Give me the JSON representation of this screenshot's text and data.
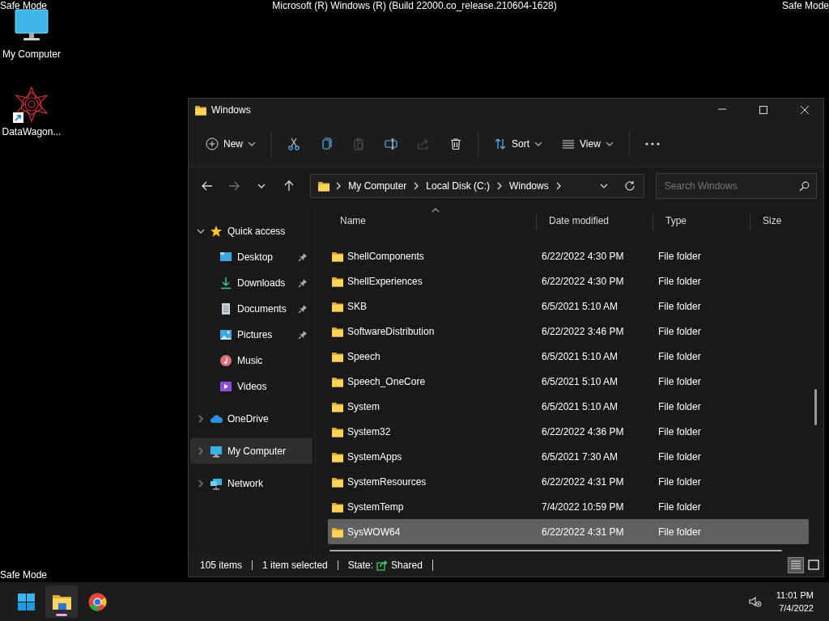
{
  "safe_mode_labels": [
    "Safe Mode",
    "Safe Mode",
    "Safe Mode"
  ],
  "build_title": "Microsoft (R) Windows (R) (Build 22000.co_release.210604-1628)",
  "desktop_icons": [
    {
      "label": "My Computer",
      "shortcut": false
    },
    {
      "label": "DataWagon...",
      "shortcut": true
    }
  ],
  "window": {
    "title": "Windows",
    "toolbar": [
      {
        "kind": "menu",
        "label": "New"
      },
      {
        "kind": "separator"
      },
      {
        "kind": "icon",
        "disabled": false
      },
      {
        "kind": "icon",
        "disabled": false
      },
      {
        "kind": "icon",
        "disabled": true
      },
      {
        "kind": "icon",
        "disabled": false
      },
      {
        "kind": "icon",
        "disabled": true
      },
      {
        "kind": "icon",
        "disabled": false
      },
      {
        "kind": "separator"
      },
      {
        "kind": "menu",
        "label": "Sort"
      },
      {
        "kind": "menu",
        "label": "View"
      },
      {
        "kind": "separator"
      },
      {
        "kind": "more"
      }
    ],
    "nav_buttons": [
      {
        "disabled": false
      },
      {
        "disabled": true
      },
      {
        "disabled": false
      },
      {
        "disabled": false
      }
    ],
    "address": {
      "crumbs": [
        "My Computer",
        "Local Disk (C:)",
        "Windows"
      ]
    },
    "search": {
      "placeholder": "Search Windows"
    },
    "nav_pane": [
      {
        "label": "Quick access",
        "expanded": true,
        "selected": false,
        "children": [
          {
            "label": "Desktop",
            "pinned": true,
            "selected": false
          },
          {
            "label": "Downloads",
            "pinned": true,
            "selected": false
          },
          {
            "label": "Documents",
            "pinned": true,
            "selected": false
          },
          {
            "label": "Pictures",
            "pinned": true,
            "selected": false
          },
          {
            "label": "Music",
            "pinned": false,
            "selected": false
          },
          {
            "label": "Videos",
            "pinned": false,
            "selected": false
          }
        ]
      },
      {
        "label": "OneDrive",
        "expanded": false,
        "selected": false
      },
      {
        "label": "My Computer",
        "expanded": false,
        "selected": true
      },
      {
        "label": "Network",
        "expanded": false,
        "selected": false
      }
    ],
    "columns": [
      {
        "label": "Name",
        "sorted": true
      },
      {
        "label": "Date modified",
        "sorted": false
      },
      {
        "label": "Type",
        "sorted": false
      },
      {
        "label": "Size",
        "sorted": false
      }
    ],
    "rows": [
      {
        "name": "ShellComponents",
        "date": "6/22/2022 4:30 PM",
        "type": "File folder",
        "selected": false
      },
      {
        "name": "ShellExperiences",
        "date": "6/22/2022 4:30 PM",
        "type": "File folder",
        "selected": false
      },
      {
        "name": "SKB",
        "date": "6/5/2021 5:10 AM",
        "type": "File folder",
        "selected": false
      },
      {
        "name": "SoftwareDistribution",
        "date": "6/22/2022 3:46 PM",
        "type": "File folder",
        "selected": false
      },
      {
        "name": "Speech",
        "date": "6/5/2021 5:10 AM",
        "type": "File folder",
        "selected": false
      },
      {
        "name": "Speech_OneCore",
        "date": "6/5/2021 5:10 AM",
        "type": "File folder",
        "selected": false
      },
      {
        "name": "System",
        "date": "6/5/2021 5:10 AM",
        "type": "File folder",
        "selected": false
      },
      {
        "name": "System32",
        "date": "6/22/2022 4:36 PM",
        "type": "File folder",
        "selected": false
      },
      {
        "name": "SystemApps",
        "date": "6/5/2021 7:30 AM",
        "type": "File folder",
        "selected": false
      },
      {
        "name": "SystemResources",
        "date": "6/22/2022 4:31 PM",
        "type": "File folder",
        "selected": false
      },
      {
        "name": "SystemTemp",
        "date": "7/4/2022 10:59 PM",
        "type": "File folder",
        "selected": false
      },
      {
        "name": "SysWOW64",
        "date": "6/22/2022 4:31 PM",
        "type": "File folder",
        "selected": true
      }
    ],
    "status": {
      "item_count": "105 items",
      "selection": "1 item selected",
      "state_label": "State:",
      "state_value": "Shared"
    },
    "view_buttons": [
      {
        "selected": true
      },
      {
        "selected": false
      }
    ]
  },
  "taskbar": {
    "apps": [
      {
        "active": false
      },
      {
        "active": true
      },
      {
        "active": false
      }
    ],
    "time": "11:01 PM",
    "date": "7/4/2022"
  }
}
